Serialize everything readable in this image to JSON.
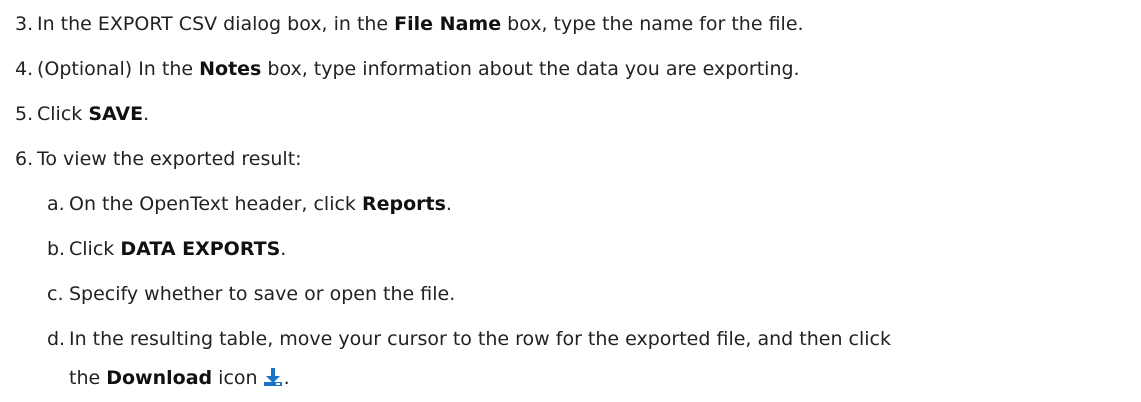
{
  "steps": [
    {
      "num": "3.",
      "before": "In the EXPORT CSV dialog box, in the ",
      "bold": "File Name",
      "after": " box, type the name for the file."
    },
    {
      "num": "4.",
      "before": "(Optional) In the ",
      "bold": "Notes",
      "after": " box, type information about the data you are exporting."
    },
    {
      "num": "5.",
      "before": "Click ",
      "bold": "SAVE",
      "after": "."
    },
    {
      "num": "6.",
      "text": "To view the exported result:"
    }
  ],
  "substeps": [
    {
      "letter": "a.",
      "before": "On the OpenText header, click ",
      "bold": "Reports",
      "after": "."
    },
    {
      "letter": "b.",
      "before": "Click ",
      "bold": "DATA EXPORTS",
      "after": "."
    },
    {
      "letter": "c.",
      "text": "Specify whether to save or open the file."
    },
    {
      "letter": "d.",
      "text": "In the resulting table, move your cursor to the row for the exported file, and then click",
      "cont_before": "the ",
      "cont_bold": "Download",
      "cont_after": " icon",
      "cont_end": "."
    }
  ],
  "icons": {
    "download": "download-icon",
    "download_color": "#1a73c8"
  }
}
